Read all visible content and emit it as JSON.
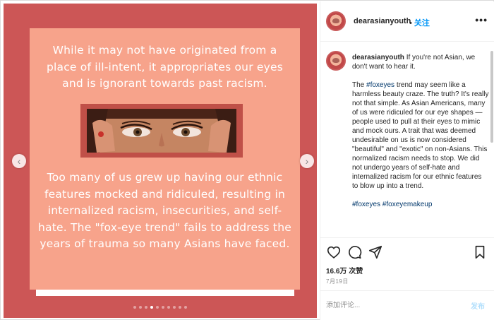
{
  "post": {
    "media": {
      "quote_top": "While it may not have originated from a place of ill-intent, it appropriates our eyes and is ignorant towards past racism.",
      "quote_bottom": "Too many of us grew up having our ethnic features mocked and ridiculed, resulting in internalized racism, insecurities, and self-hate. The \"fox-eye trend\" fails to address the years of trauma so many Asians have faced.",
      "prev_icon": "‹",
      "next_icon": "›",
      "carousel": {
        "count": 10,
        "active_index": 3
      }
    },
    "header": {
      "username": "dearasianyouth",
      "separator": "•",
      "follow_label": "关注",
      "more_icon": "•••"
    },
    "caption": {
      "username": "dearasianyouth",
      "first_line": "If you're not Asian, we don't want to hear it.",
      "para2_prefix": "The ",
      "para2_hashtag": "#foxeyes",
      "para2_rest": " trend may seem like a harmless beauty craze. The truth? It's really not that simple. As Asian Americans, many of us were ridiculed for our eye shapes — people used to pull at their eyes to mimic and mock ours. A trait that was deemed undesirable on us is now considered \"beautiful\" and \"exotic\" on non-Asians. This normalized racism needs to stop. We did not undergo years of self-hate and internalized racism for our ethnic features to blow up into a trend.",
      "hashtags": "#foxeyes #foxeyemakeup"
    },
    "actions": {
      "likes": "16.6万 次赞",
      "date": "7月19日"
    },
    "comment_box": {
      "placeholder": "添加评论...",
      "post_label": "发布"
    },
    "colors": {
      "media_bg": "#cc5656",
      "card_bg": "#f7a38b",
      "accent_blue": "#0095f6"
    }
  }
}
